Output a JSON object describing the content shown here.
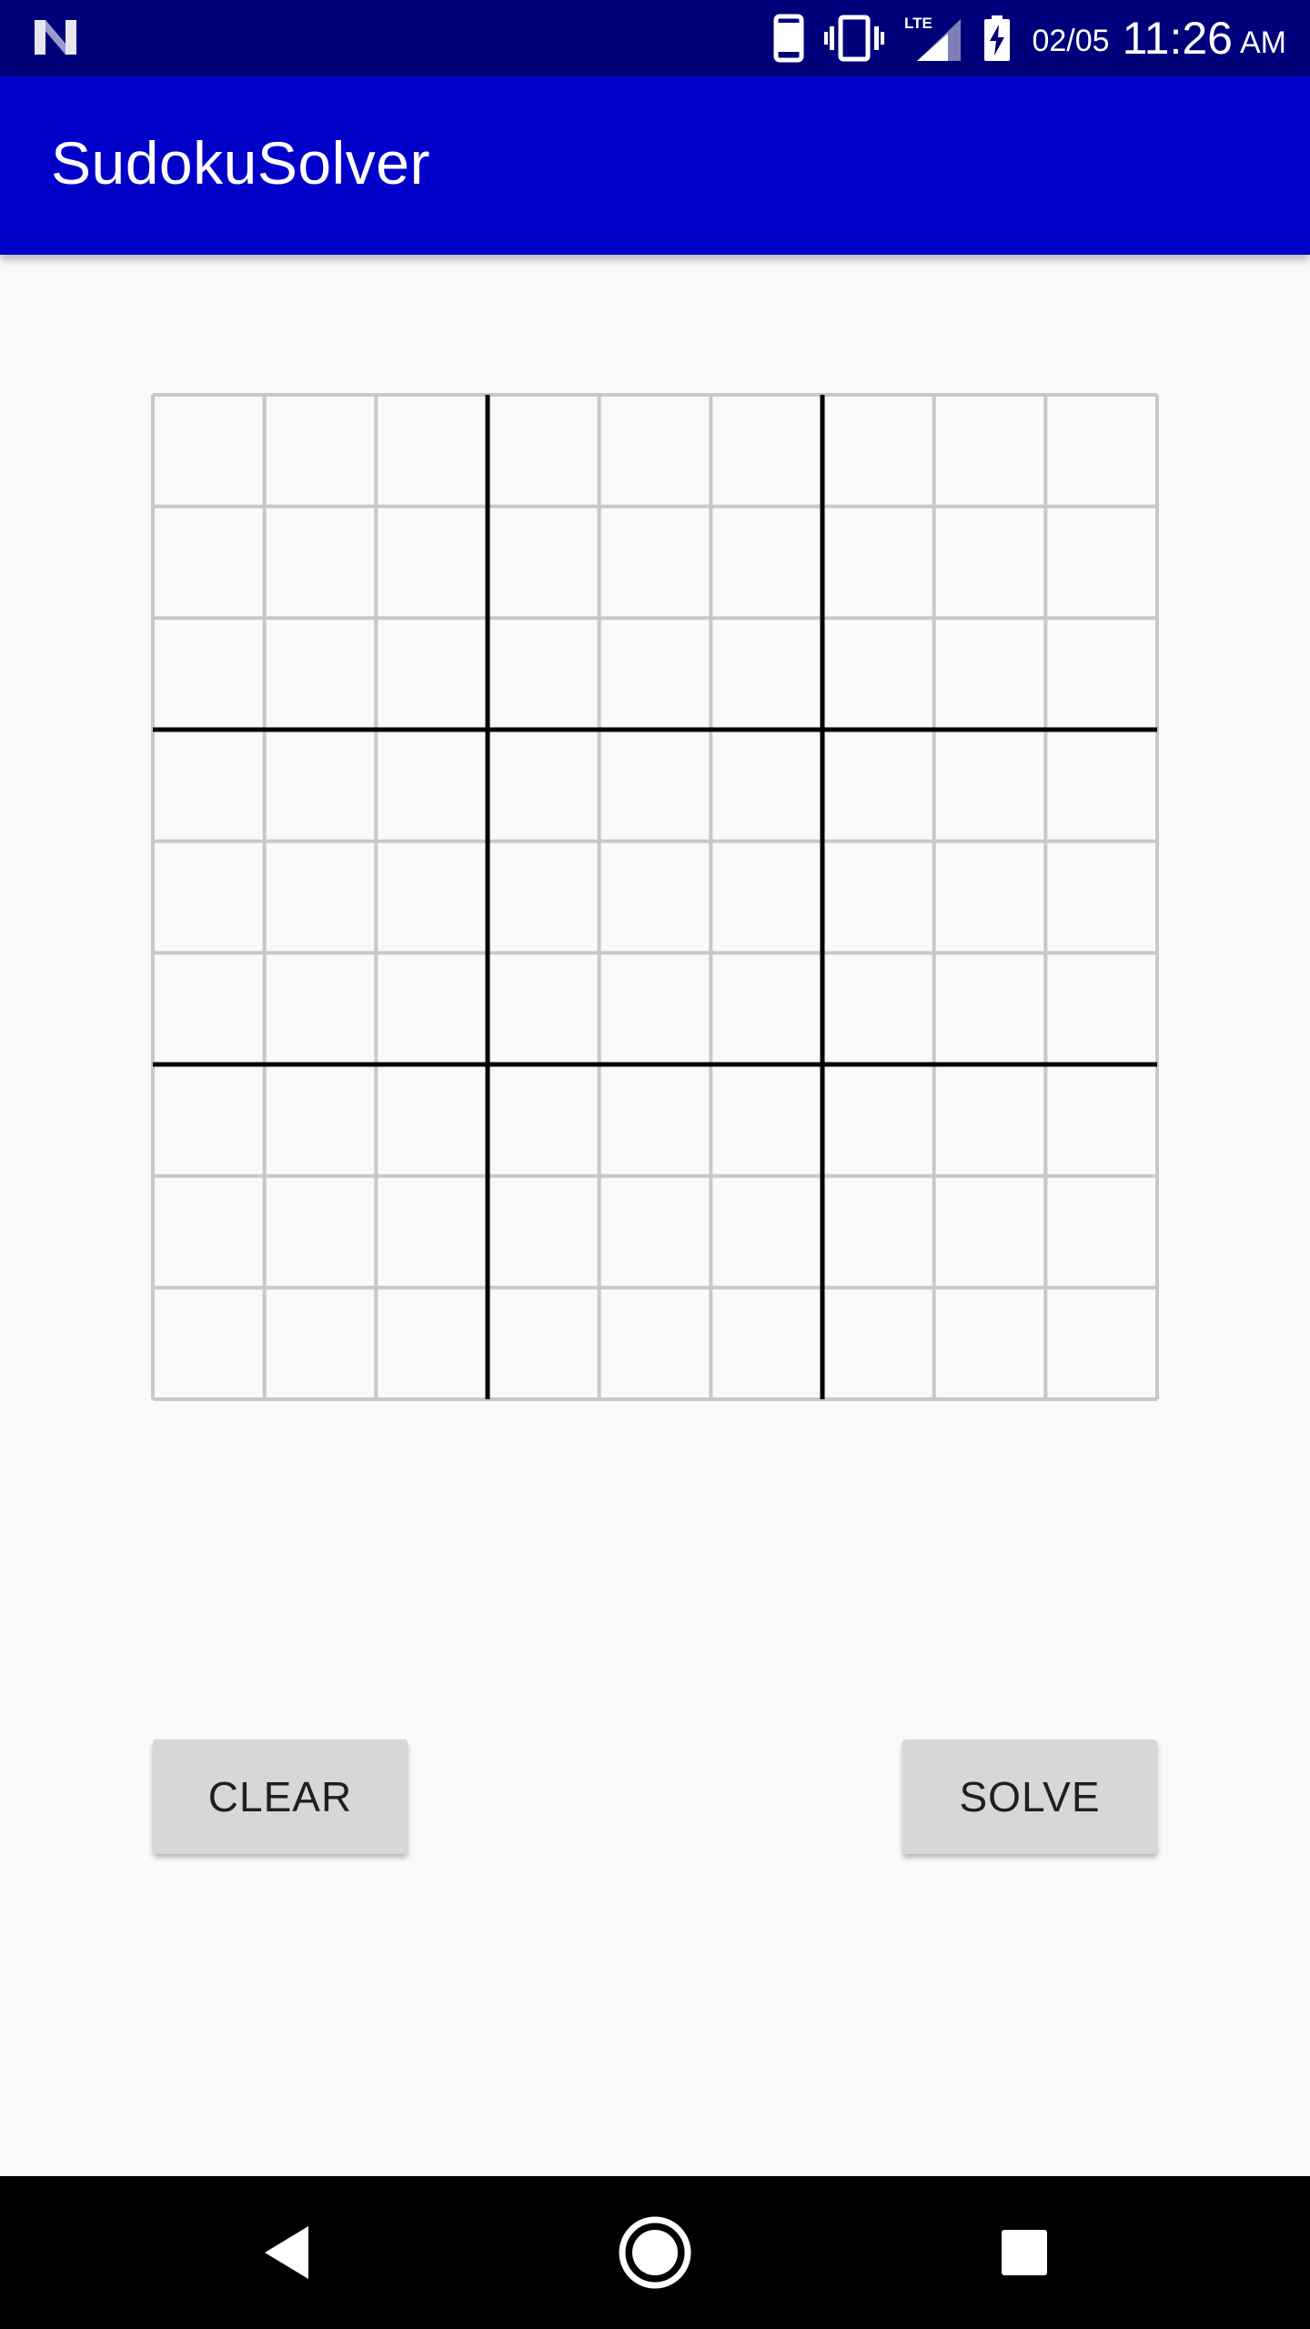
{
  "status_bar": {
    "date": "02/05",
    "time": "11:26",
    "ampm": "AM",
    "icons": [
      "notification-n-icon",
      "phone-icon",
      "vibrate-icon",
      "lte-signal-icon",
      "battery-charging-icon"
    ],
    "lte_label": "LTE"
  },
  "app_bar": {
    "title": "SudokuSolver",
    "color": "#0000c8",
    "status_color": "#00007a"
  },
  "grid": {
    "rows": 9,
    "cols": 9,
    "box_size": 3,
    "thin_line_color": "#c8c8c8",
    "thick_line_color": "#000000",
    "cells": [
      [
        "",
        "",
        "",
        "",
        "",
        "",
        "",
        "",
        ""
      ],
      [
        "",
        "",
        "",
        "",
        "",
        "",
        "",
        "",
        ""
      ],
      [
        "",
        "",
        "",
        "",
        "",
        "",
        "",
        "",
        ""
      ],
      [
        "",
        "",
        "",
        "",
        "",
        "",
        "",
        "",
        ""
      ],
      [
        "",
        "",
        "",
        "",
        "",
        "",
        "",
        "",
        ""
      ],
      [
        "",
        "",
        "",
        "",
        "",
        "",
        "",
        "",
        ""
      ],
      [
        "",
        "",
        "",
        "",
        "",
        "",
        "",
        "",
        ""
      ],
      [
        "",
        "",
        "",
        "",
        "",
        "",
        "",
        "",
        ""
      ],
      [
        "",
        "",
        "",
        "",
        "",
        "",
        "",
        "",
        ""
      ]
    ]
  },
  "buttons": {
    "clear_label": "CLEAR",
    "solve_label": "SOLVE"
  },
  "nav_bar": {
    "icons": [
      "back-icon",
      "home-icon",
      "recents-icon"
    ]
  }
}
